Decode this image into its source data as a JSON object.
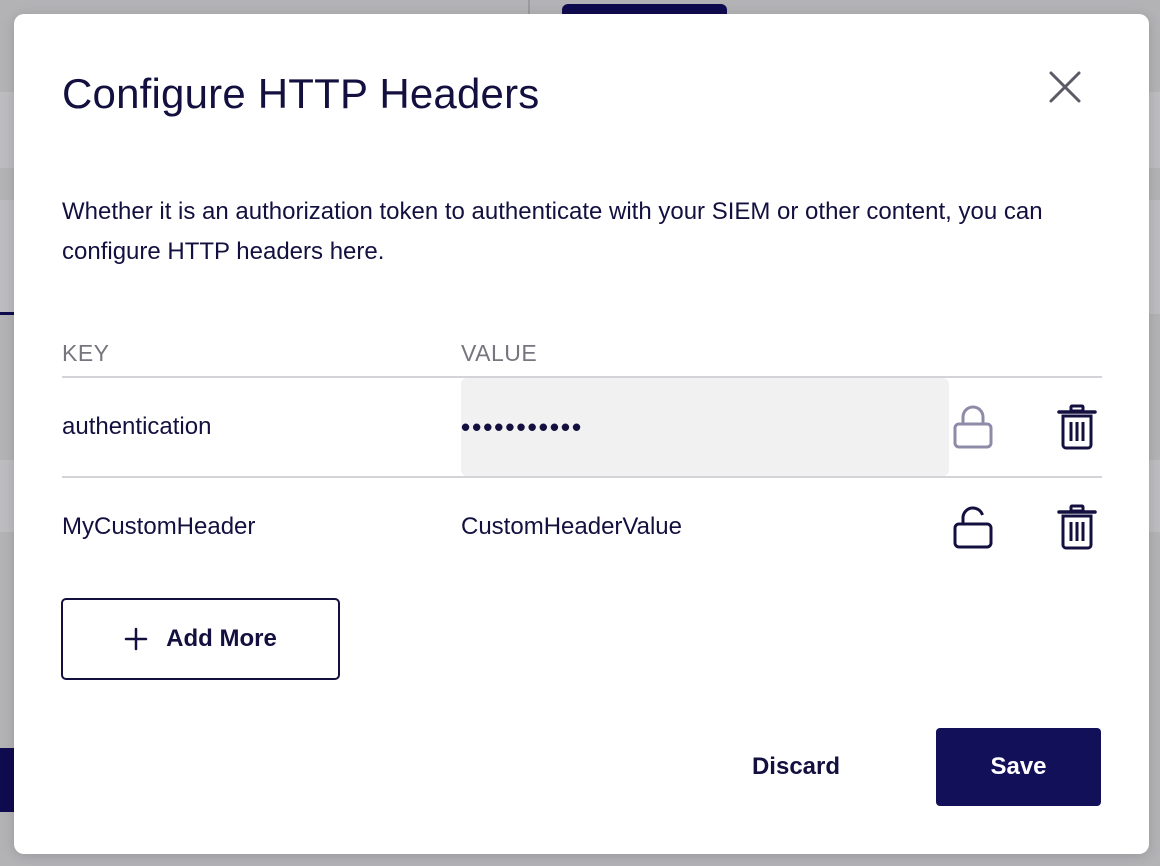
{
  "modal": {
    "title": "Configure HTTP Headers",
    "description": "Whether it is an authorization token to authenticate with your SIEM or other content, you can configure HTTP headers here.",
    "close_icon": "close-icon"
  },
  "table": {
    "headers": {
      "key": "KEY",
      "value": "VALUE"
    },
    "rows": [
      {
        "key": "authentication",
        "value": "•••••••••••",
        "masked": true,
        "lock_icon": "lock-closed-icon",
        "delete_icon": "trash-icon"
      },
      {
        "key": "MyCustomHeader",
        "value": "CustomHeaderValue",
        "masked": false,
        "lock_icon": "lock-open-icon",
        "delete_icon": "trash-icon"
      }
    ]
  },
  "actions": {
    "add_more_label": "Add More",
    "discard_label": "Discard",
    "save_label": "Save"
  },
  "colors": {
    "primary": "#13105a",
    "text": "#13103f",
    "muted": "#77767e",
    "masked_bg": "#f1f1f2",
    "lock_disabled": "#8e8ba8"
  }
}
